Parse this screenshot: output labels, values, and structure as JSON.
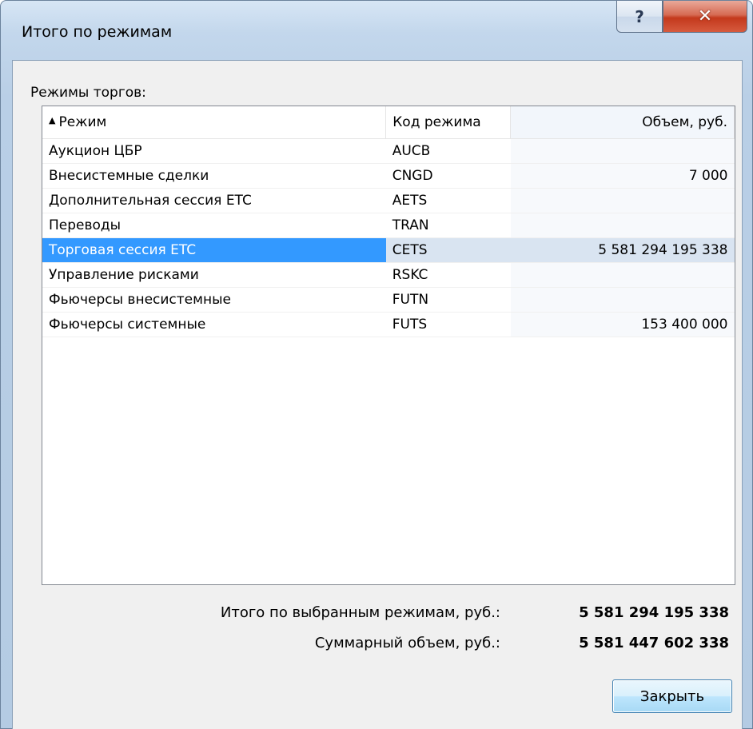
{
  "window": {
    "title": "Итого по режимам",
    "help_glyph": "?",
    "close_glyph": "✕"
  },
  "group_label": "Режимы торгов:",
  "table": {
    "sort_arrow": "▲",
    "headers": {
      "mode": "Режим",
      "code": "Код режима",
      "volume": "Объем, руб."
    },
    "rows": [
      {
        "mode": "Аукцион ЦБР",
        "code": "AUCB",
        "volume": ""
      },
      {
        "mode": "Внесистемные сделки",
        "code": "CNGD",
        "volume": "7 000"
      },
      {
        "mode": "Дополнительная сессия ETC",
        "code": "AETS",
        "volume": ""
      },
      {
        "mode": "Переводы",
        "code": "TRAN",
        "volume": ""
      },
      {
        "mode": "Торговая сессия ETC",
        "code": "CETS",
        "volume": "5 581 294 195 338"
      },
      {
        "mode": "Управление рисками",
        "code": "RSKC",
        "volume": ""
      },
      {
        "mode": "Фьючерсы внесистемные",
        "code": "FUTN",
        "volume": ""
      },
      {
        "mode": "Фьючерсы системные",
        "code": "FUTS",
        "volume": "153 400 000"
      }
    ],
    "selected_row_index": 4
  },
  "totals": {
    "selected_label": "Итого по выбранным режимам, руб.:",
    "selected_value": "5 581 294 195 338",
    "sum_label": "Суммарный объем, руб.:",
    "sum_value": "5 581 447 602 338"
  },
  "close_button_label": "Закрыть",
  "colors": {
    "selection": "#3399ff",
    "selection_secondary": "#d9e4f1",
    "close_button": "#c4391c"
  }
}
